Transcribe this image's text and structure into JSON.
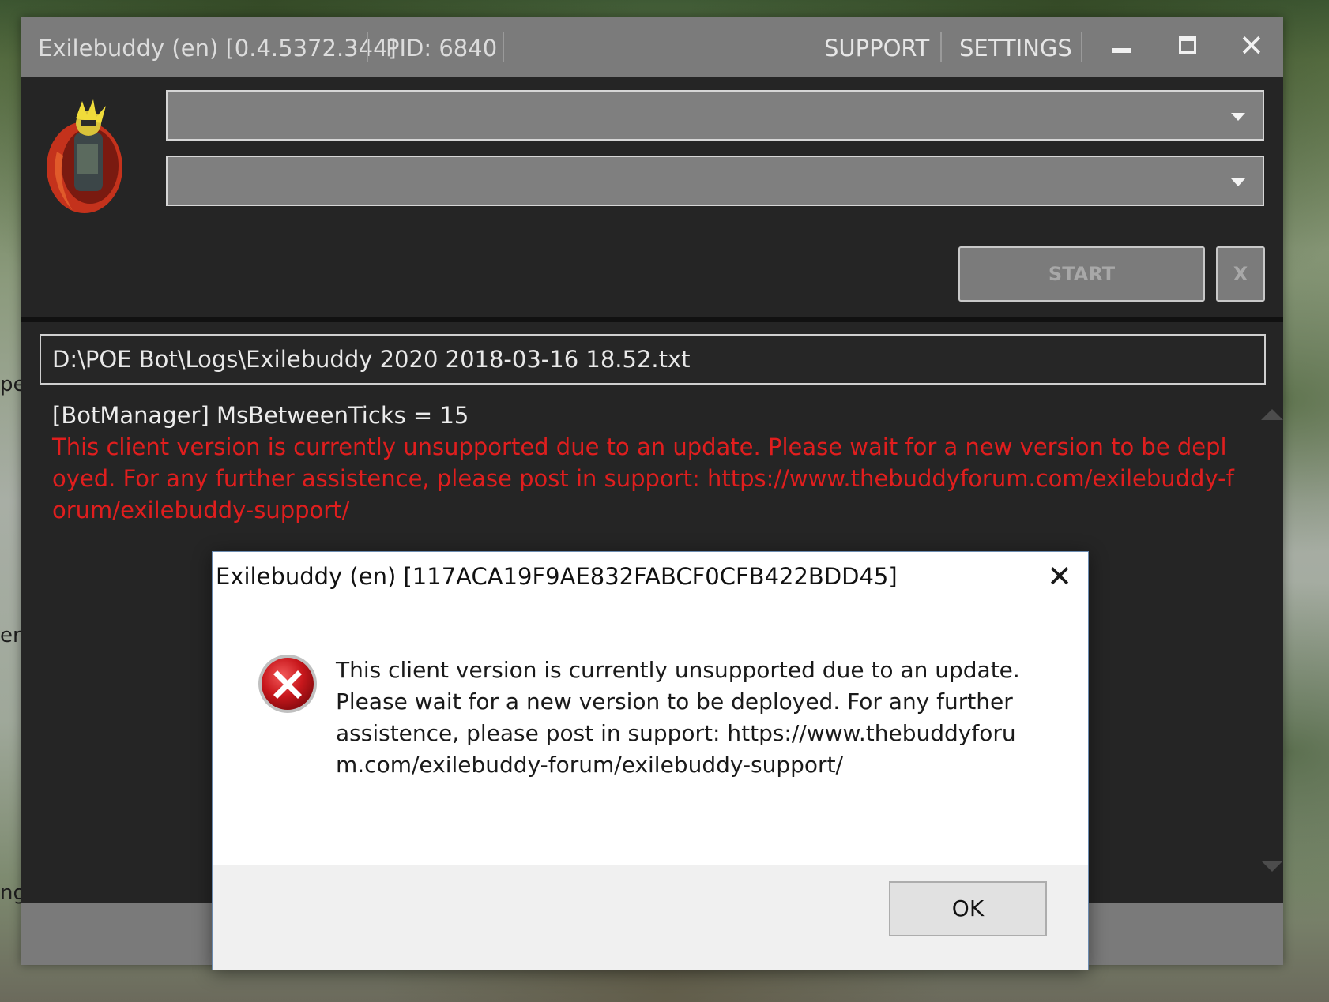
{
  "desktop": {
    "edge_fragments": [
      "pe",
      "er",
      "ng"
    ]
  },
  "main_window": {
    "title": "Exilebuddy (en) [0.4.5372.344]",
    "pid": "PID: 6840",
    "nav": {
      "support": "SUPPORT",
      "settings": "SETTINGS"
    },
    "window_controls": {
      "minimize_icon": "minimize-icon",
      "maximize_icon": "maximize-icon",
      "close_icon": "close-icon",
      "close_glyph": "✕"
    },
    "logo_icon": "exilebuddy-logo",
    "dropdown_1_value": "",
    "dropdown_2_value": "",
    "start_label": "START",
    "stop_label": "X",
    "log_file_path": "D:\\POE Bot\\Logs\\Exilebuddy 2020 2018-03-16 18.52.txt",
    "log_lines": {
      "info": "[BotManager] MsBetweenTicks = 15",
      "error": "This client version is currently unsupported due to an update. Please wait for a new version to be deployed. For any further assistence, please post in support: https://www.thebuddyforum.com/exilebuddy-forum/exilebuddy-support/"
    },
    "colors": {
      "titlebar": "#7b7b7b",
      "background": "#252525",
      "error_text": "#e01e1e"
    }
  },
  "dialog": {
    "title": "Exilebuddy (en) [117ACA19F9AE832FABCF0CFB422BDD45]",
    "close_glyph": "✕",
    "icon": "error-icon",
    "message": "This client version is currently unsupported due to an update. Please wait for a new version to be deployed. For any further assistence, please post in support: https://www.thebuddyforum.com/exilebuddy-forum/exilebuddy-support/",
    "ok_label": "OK"
  }
}
